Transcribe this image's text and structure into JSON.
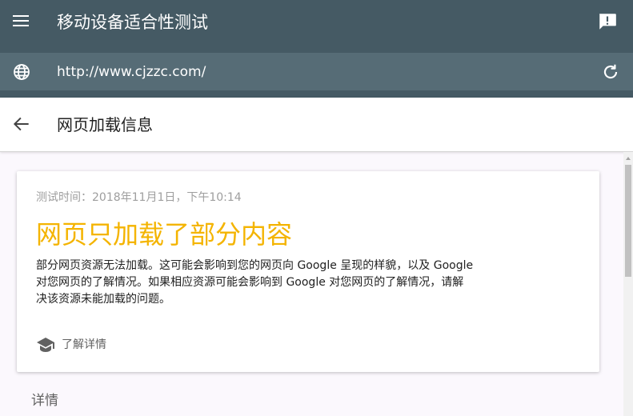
{
  "app": {
    "title": "移动设备适合性测试",
    "menu_icon": "menu-icon",
    "feedback_icon": "feedback-icon"
  },
  "url_bar": {
    "url": "http://www.cjzzc.com/",
    "globe_icon": "globe-icon",
    "reload_icon": "reload-icon"
  },
  "subheader": {
    "title": "网页加载信息",
    "back_icon": "arrow-back-icon"
  },
  "card": {
    "test_time": "测试时间：2018年11月1日，下午10:14",
    "headline": "网页只加载了部分内容",
    "description": "部分网页资源无法加载。这可能会影响到您的网页向 Google 呈现的样貌，以及 Google 对您网页的了解情况。如果相应资源可能会影响到 Google 对您网页的了解情况，请解决该资源未能加载的问题。",
    "learn_more": "了解详情",
    "learn_icon": "school-cap-icon"
  },
  "details": {
    "heading": "详情"
  },
  "colors": {
    "app_bar": "#455a64",
    "url_bar": "#566c76",
    "headline": "#f4b400"
  }
}
